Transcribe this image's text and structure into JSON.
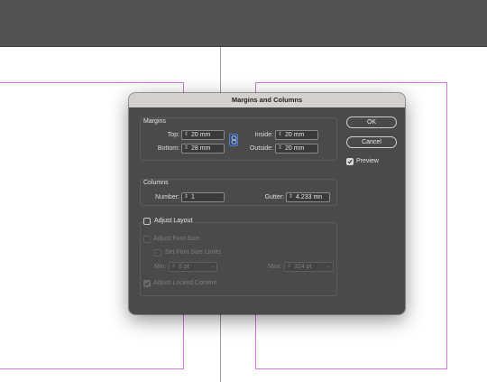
{
  "dialog": {
    "title": "Margins and Columns",
    "margins": {
      "group_label": "Margins",
      "top_label": "Top:",
      "top_value": "20 mm",
      "bottom_label": "Bottom:",
      "bottom_value": "28 mm",
      "inside_label": "Inside:",
      "inside_value": "20 mm",
      "outside_label": "Outside:",
      "outside_value": "20 mm"
    },
    "columns": {
      "group_label": "Columns",
      "number_label": "Number:",
      "number_value": "1",
      "gutter_label": "Gutter:",
      "gutter_value": "4.233 mn"
    },
    "adjust": {
      "adjust_layout_label": "Adjust Layout",
      "adjust_layout_checked": false,
      "adjust_font_size_label": "Adjust Font Size",
      "set_font_size_limits_label": "Set Font Size Limits",
      "min_label": "Min:",
      "min_value": "6 pt",
      "max_label": "Max:",
      "max_value": "324 pt",
      "adjust_locked_label": "Adjust Locked Content",
      "adjust_locked_checked": true
    },
    "buttons": {
      "ok": "OK",
      "cancel": "Cancel"
    },
    "preview": {
      "label": "Preview",
      "checked": true
    }
  },
  "colors": {
    "margin_guide": "#d276e0",
    "dialog_bg": "#4a4a4a",
    "titlebar_bg": "#d6d0cc",
    "link_accent": "#4d7dd6"
  },
  "icons": [
    "spinner-icon",
    "chain-link-icon",
    "checkmark-icon",
    "chevron-down-icon"
  ]
}
